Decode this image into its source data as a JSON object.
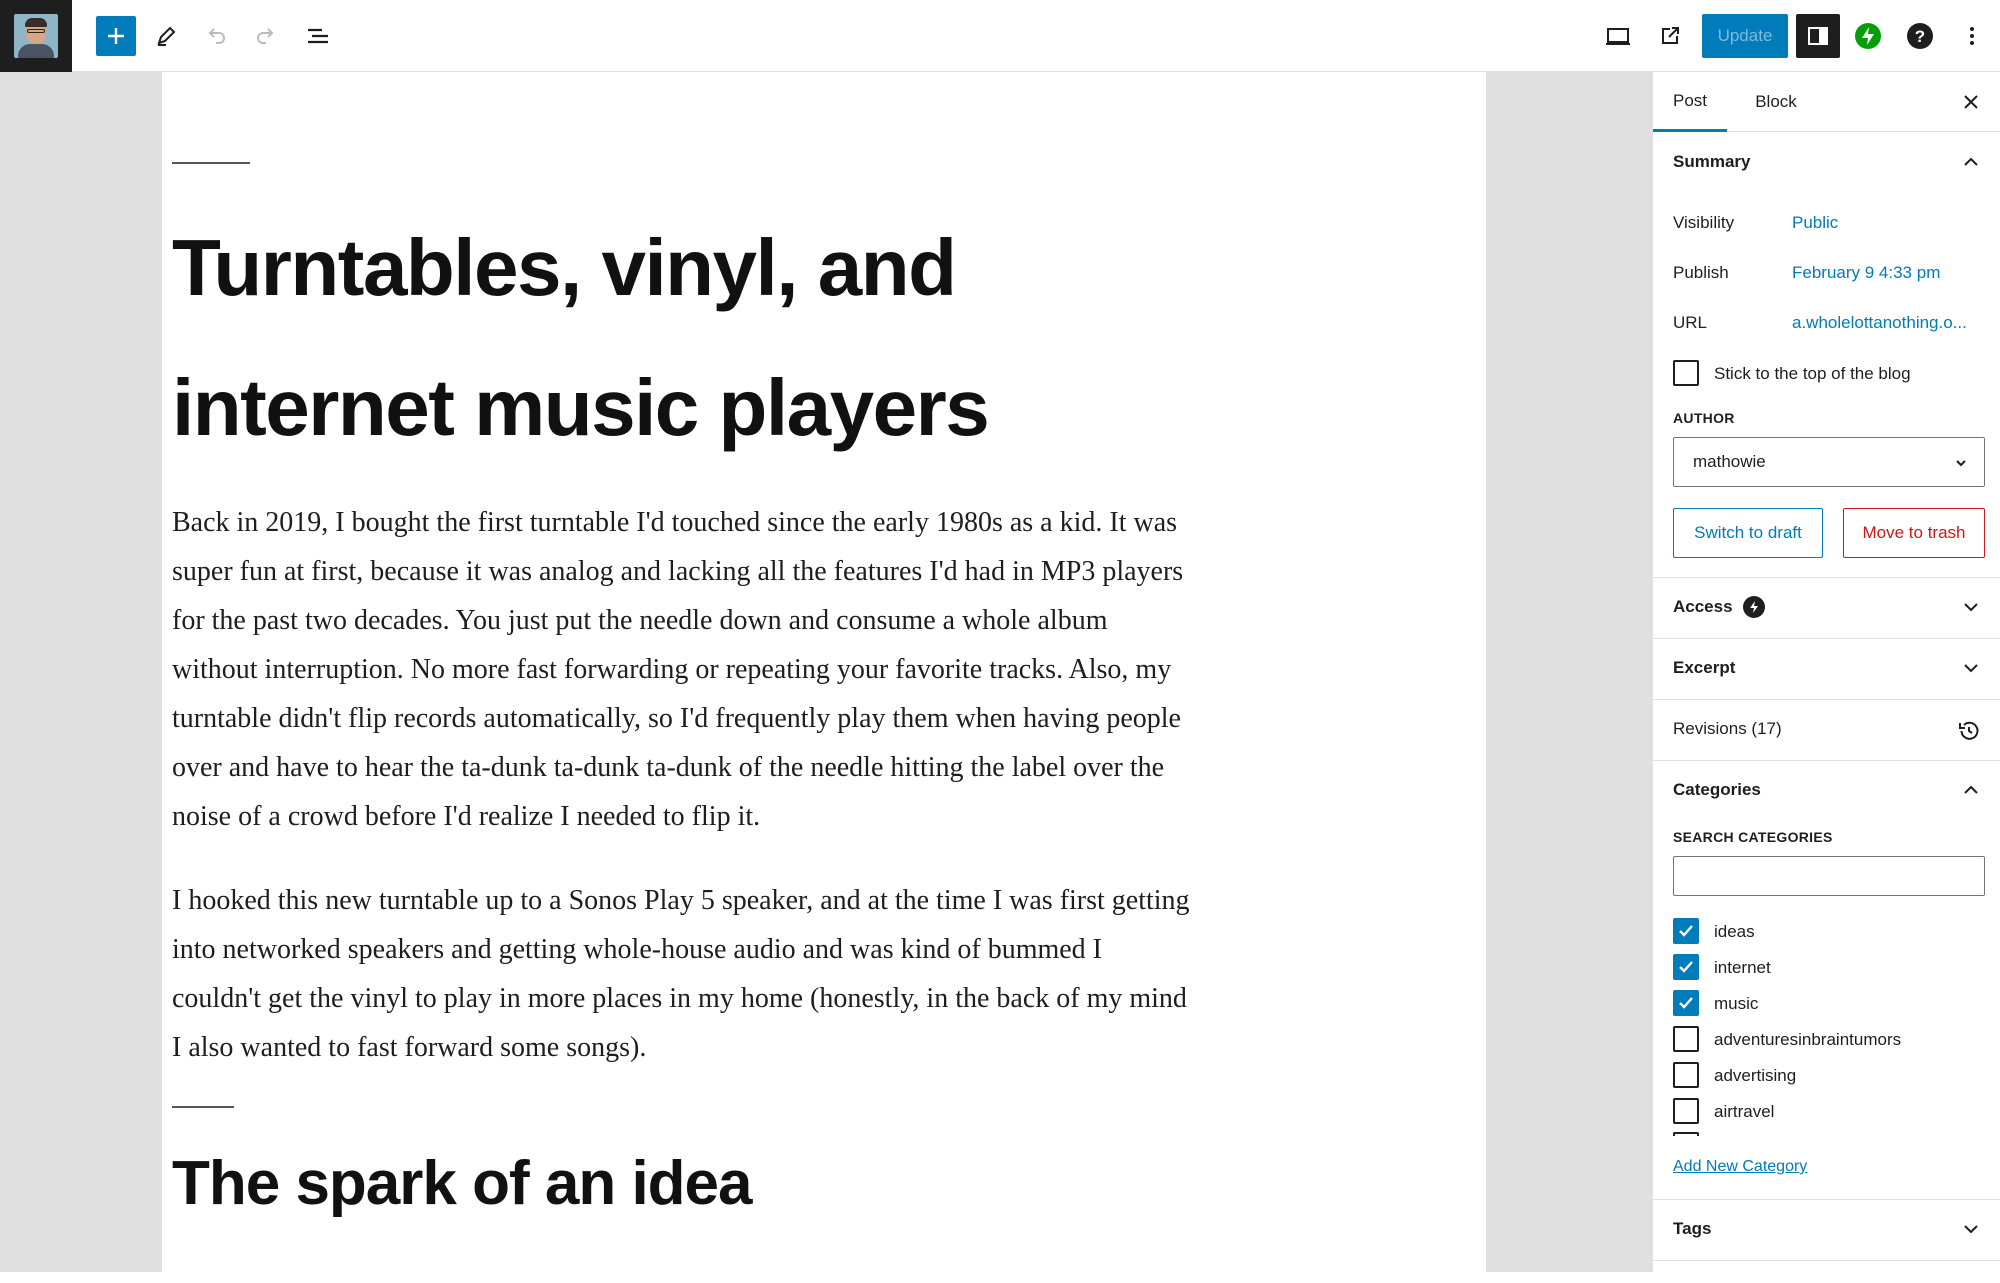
{
  "toolbar": {
    "update_label": "Update",
    "icons": [
      "site-avatar",
      "plus-icon",
      "pencil-icon",
      "undo-icon",
      "redo-icon",
      "list-view-icon",
      "desktop-preview-icon",
      "external-link-icon",
      "sidebar-toggle-icon",
      "jetpack-bolt-icon",
      "help-icon",
      "more-vertical-icon"
    ]
  },
  "colors": {
    "accent": "#007cba",
    "danger": "#cc1818",
    "jetpack": "#069e08",
    "dark": "#1e1e1e",
    "canvas_bg": "#e0e0e0"
  },
  "post": {
    "title": "Turntables, vinyl, and internet music players",
    "paragraphs": [
      "Back in 2019, I bought the first turntable I'd touched since the early 1980s as a kid. It was super fun at first, because it was analog and lacking all the features I'd had in MP3 players for the past two decades. You just put the needle down and consume a whole album without interruption. No more fast forwarding or repeating your favorite tracks. Also, my turntable didn't flip records automatically, so I'd frequently play them when having people over and have to hear the ta-dunk ta-dunk ta-dunk of the needle hitting the label over the noise of a crowd before I'd realize I needed to flip it.",
      "I hooked this new turntable up to a Sonos Play 5 speaker, and at the time I was first getting into networked speakers and getting whole-house audio and was kind of bummed I couldn't get the vinyl to play in more places in my home (honestly, in the back of my mind I also wanted to fast forward some songs)."
    ],
    "heading2": "The spark of an idea"
  },
  "sidebar": {
    "tabs": [
      "Post",
      "Block"
    ],
    "summary": {
      "title": "Summary",
      "visibility_label": "Visibility",
      "visibility_value": "Public",
      "publish_label": "Publish",
      "publish_value": "February 9 4:33 pm",
      "url_label": "URL",
      "url_value": "a.wholelottanothing.o...",
      "sticky_label": "Stick to the top of the blog",
      "author_label": "AUTHOR",
      "author_value": "mathowie",
      "switch_draft": "Switch to draft",
      "move_trash": "Move to trash"
    },
    "access": "Access",
    "excerpt": "Excerpt",
    "revisions": "Revisions (17)",
    "categories": {
      "title": "Categories",
      "search_label": "SEARCH CATEGORIES",
      "search_value": "",
      "items": [
        {
          "label": "ideas",
          "checked": true
        },
        {
          "label": "internet",
          "checked": true
        },
        {
          "label": "music",
          "checked": true
        },
        {
          "label": "adventuresinbraintumors",
          "checked": false
        },
        {
          "label": "advertising",
          "checked": false
        },
        {
          "label": "airtravel",
          "checked": false
        }
      ],
      "add_new": "Add New Category"
    },
    "tags": "Tags"
  }
}
